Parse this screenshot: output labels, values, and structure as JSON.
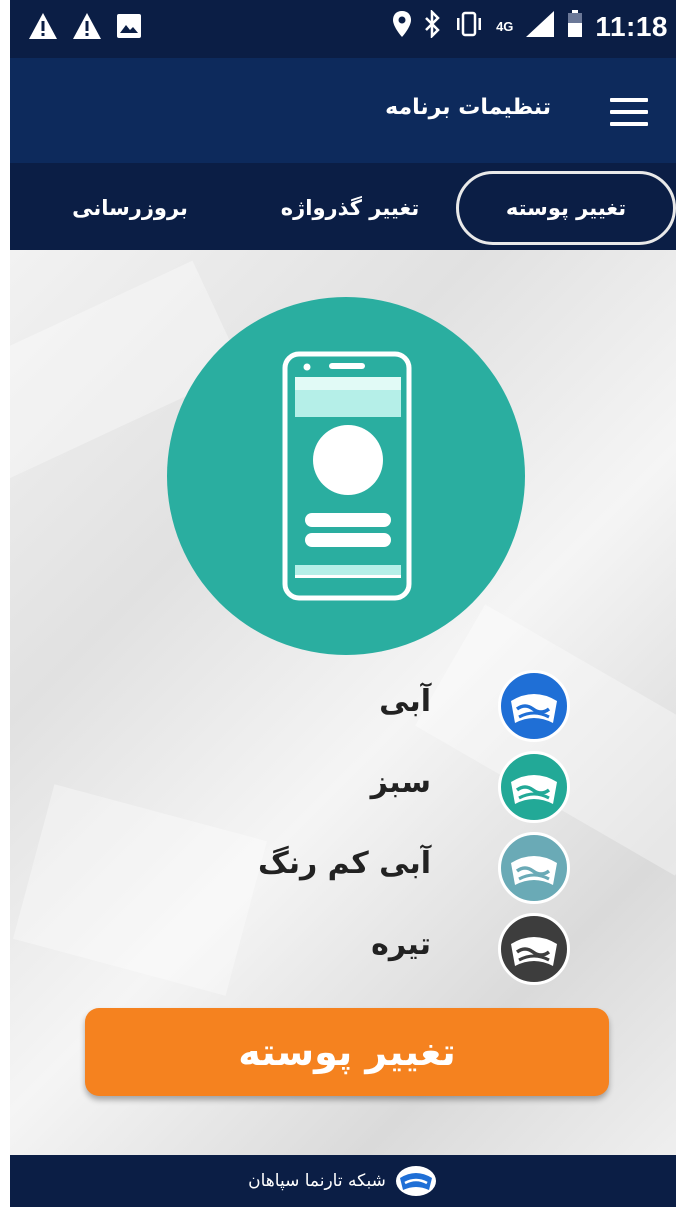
{
  "status_bar": {
    "time": "11:18",
    "network": "4G",
    "icons": [
      "warning-icon",
      "warning-icon",
      "image-icon",
      "location-icon",
      "bluetooth-icon",
      "vibrate-icon",
      "signal-icon",
      "battery-icon"
    ]
  },
  "app_bar": {
    "title": "تنظیمات برنامه",
    "menu_icon": "menu-icon"
  },
  "tabs": [
    {
      "label": "تغییر پوسته",
      "active": true
    },
    {
      "label": "تغییر گذرواژه",
      "active": false
    },
    {
      "label": "بروزرسانی",
      "active": false
    }
  ],
  "hero": {
    "icon": "phone-icon",
    "color": "#2aaea0"
  },
  "theme_options": [
    {
      "label": "آبی",
      "color": "#1f6fd6"
    },
    {
      "label": "سبز",
      "color": "#22a997"
    },
    {
      "label": "آبی کم رنگ",
      "color": "#6aaab6"
    },
    {
      "label": "تیره",
      "color": "#3d3d3d"
    }
  ],
  "apply_button": {
    "label": "تغییر پوسته",
    "color": "#f5821f"
  },
  "footer": {
    "text": "شبکه تارنما سپاهان"
  }
}
